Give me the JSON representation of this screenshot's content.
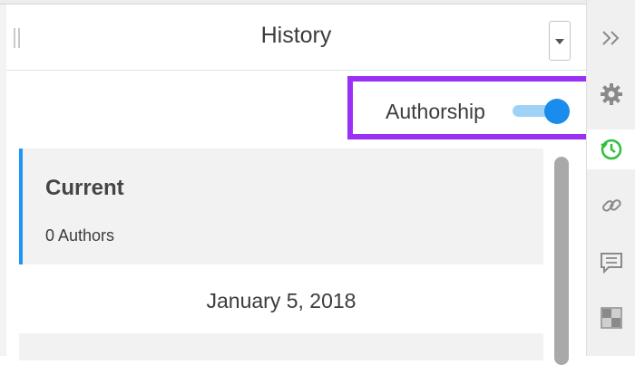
{
  "panel": {
    "title": "History",
    "authorship_label": "Authorship",
    "authorship_enabled": true
  },
  "history": {
    "current": {
      "title": "Current",
      "authors": "0 Authors"
    },
    "date_group": "January 5, 2018"
  },
  "rail": {
    "items": [
      {
        "icon": "double-chevron-right-icon"
      },
      {
        "icon": "gear-icon"
      },
      {
        "icon": "history-clock-icon",
        "active": true
      },
      {
        "icon": "link-icon"
      },
      {
        "icon": "comment-icon"
      },
      {
        "icon": "checker-grid-icon"
      }
    ]
  },
  "colors": {
    "highlight": "#9b30f5",
    "accent_blue": "#1a8cec",
    "active_green": "#2fbf3a"
  }
}
